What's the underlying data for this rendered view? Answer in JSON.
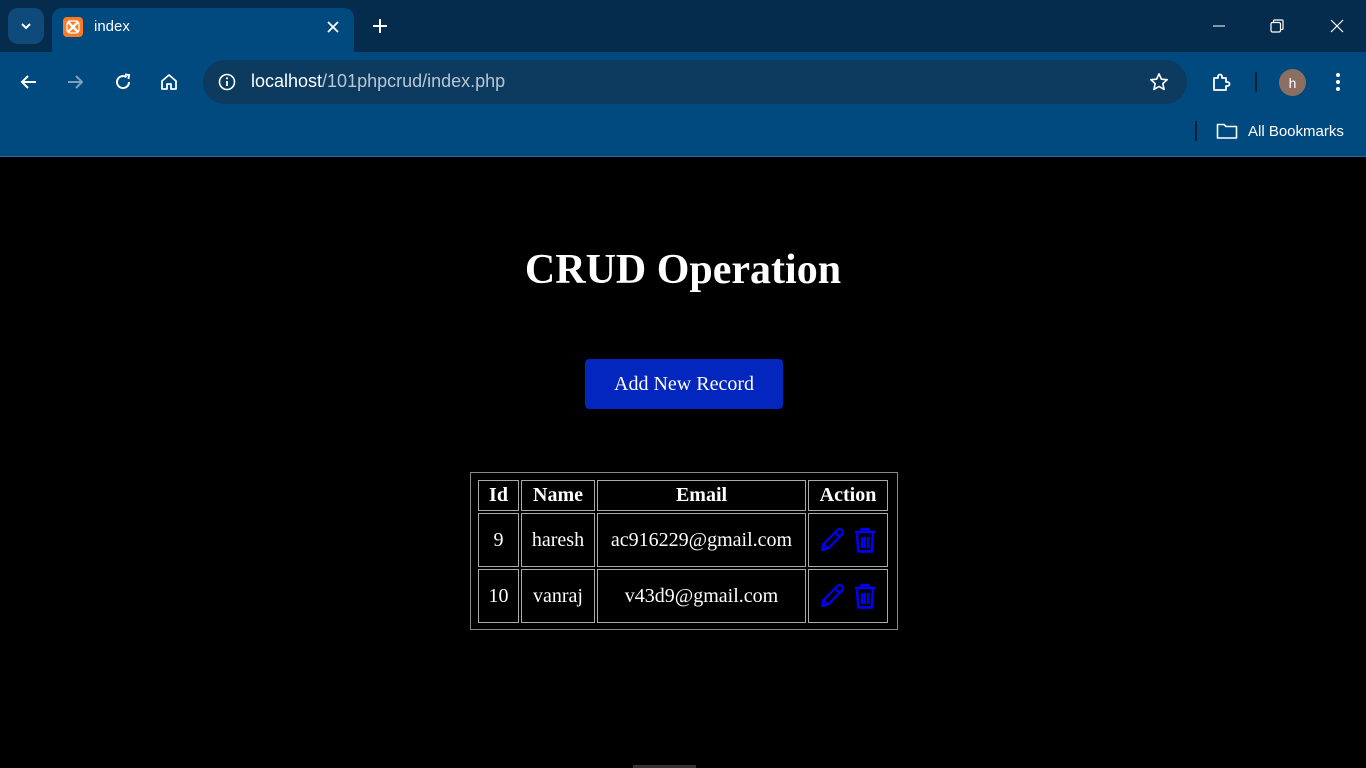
{
  "browser": {
    "tab": {
      "title": "index"
    },
    "address": {
      "host": "localhost",
      "path": "/101phpcrud/index.php"
    },
    "profile_initial": "h",
    "bookmarks": {
      "all_label": "All Bookmarks"
    }
  },
  "page": {
    "title": "CRUD Operation",
    "add_button": "Add New Record",
    "table": {
      "headers": {
        "id": "Id",
        "name": "Name",
        "email": "Email",
        "action": "Action"
      },
      "rows": [
        {
          "id": "9",
          "name": "haresh",
          "email": "ac916229@gmail.com"
        },
        {
          "id": "10",
          "name": "vanraj",
          "email": "v43d9@gmail.com"
        }
      ]
    }
  },
  "colors": {
    "tabstrip": "#062c4d",
    "toolbar": "#014a80",
    "accent_button": "#0326be",
    "action_icons": "#0000ff"
  },
  "icons": [
    "tab-search-icon",
    "xampp-favicon-icon",
    "close-icon",
    "plus-icon",
    "minimize-icon",
    "restore-icon",
    "back-arrow-icon",
    "forward-arrow-icon",
    "reload-icon",
    "home-icon",
    "info-icon",
    "star-icon",
    "extensions-icon",
    "kebab-menu-icon",
    "folder-icon",
    "pencil-icon",
    "trash-icon"
  ]
}
